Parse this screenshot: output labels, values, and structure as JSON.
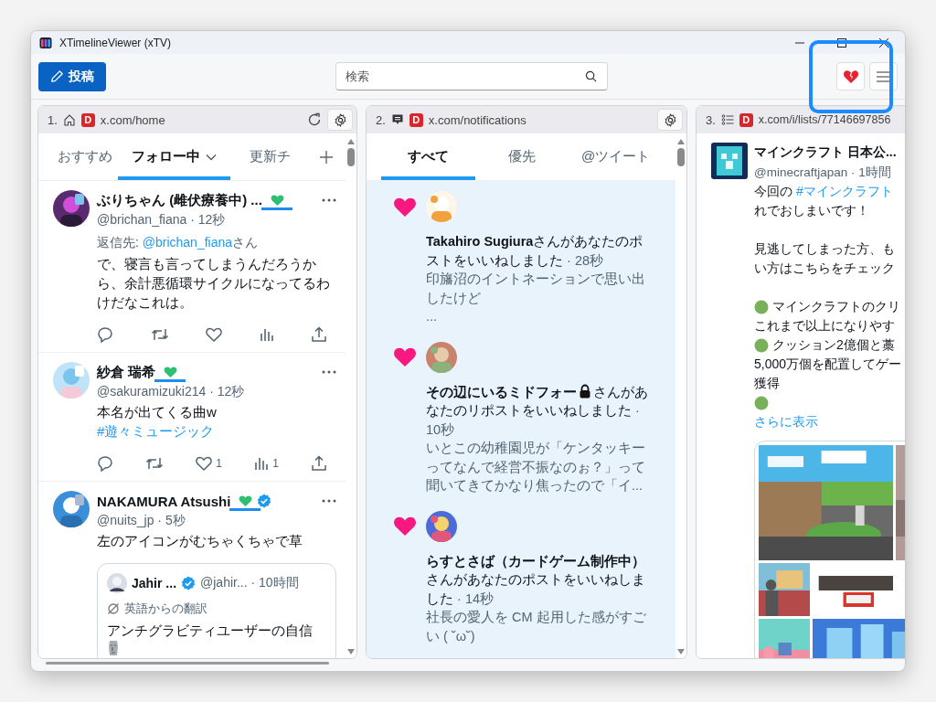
{
  "window": {
    "title": "XTimelineViewer (xTV)"
  },
  "toolbar": {
    "post_button": "投稿",
    "search": {
      "placeholder": "検索"
    },
    "highlighted": true
  },
  "columns": [
    {
      "index": "1.",
      "kind": "home",
      "badge": "D",
      "url": "x.com/home",
      "refresh": true,
      "settings": true,
      "add_tab": true,
      "unread": false,
      "tabs": [
        {
          "label": "おすすめ",
          "selected": false,
          "dropdown": false
        },
        {
          "label": "フォロー中",
          "selected": true,
          "dropdown": true
        },
        {
          "label": "更新チ",
          "selected": false,
          "dropdown": false
        }
      ],
      "posts": [
        {
          "name": "ぶりちゃん (雌伏療養中) ...",
          "green_heart": true,
          "verified": false,
          "meta": "@brichan_fiana · 12秒",
          "reply_to": {
            "label": "返信先: ",
            "handle": "@brichan_fiana",
            "suffix": "さん"
          },
          "segments": [
            {
              "kind": "text",
              "text": "で、寝言も言ってしまうんだろうから、余計悪循環サイクルになってるわけだなこれは。"
            }
          ]
        },
        {
          "name": "紗倉 瑞希",
          "green_heart": true,
          "verified": false,
          "meta": "@sakuramizuki214 · 12秒",
          "segments": [
            {
              "kind": "text",
              "text": "本名が出てくる曲w "
            },
            {
              "kind": "link",
              "text": "#遊々ミュージック"
            }
          ],
          "likes": "1",
          "views": "1"
        },
        {
          "name": "NAKAMURA Atsushi",
          "green_heart": true,
          "verified": true,
          "meta": "@nuits_jp · 5秒",
          "segments": [
            {
              "kind": "text",
              "text": "左のアイコンがむちゃくちゃで草"
            }
          ],
          "quote": {
            "name": "Jahir ...",
            "verified": true,
            "meta": "@jahir... · 10時間",
            "translated": "英語からの翻訳",
            "text": "アンチグラビティユーザーの自信"
          }
        }
      ]
    },
    {
      "index": "2.",
      "kind": "notifications",
      "badge": "D",
      "url": "x.com/notifications",
      "refresh": false,
      "settings": true,
      "add_tab": false,
      "unread": true,
      "tabs": [
        {
          "label": "すべて",
          "selected": true,
          "dropdown": false
        },
        {
          "label": "優先",
          "selected": false,
          "dropdown": false
        },
        {
          "label": "@ツイート",
          "selected": false,
          "dropdown": false
        }
      ],
      "notifications": [
        {
          "actor": "Takahiro Sugiura",
          "locked": false,
          "action": "さんがあなたのポストをいいねしました",
          "time": " · 28秒",
          "excerpt": "印旛沼のイントネーションで思い出したけど",
          "more": "..."
        },
        {
          "actor": "その辺にいるミドフォー",
          "locked": true,
          "action": "さんがあなたのリポストをいいねしました",
          "time": " · 10秒",
          "excerpt": "いとこの幼稚園児が「ケンタッキーってなんで経営不振なのぉ？」って聞いてきてかなり焦ったので「イ..."
        },
        {
          "actor": "らすとさば（カードゲーム制作中）",
          "locked": false,
          "action": "さんがあなたのポストをいいねしました",
          "time": " · 14秒",
          "excerpt": "社長の愛人を CM 起用した感がすごい ( ˘ω˘)"
        }
      ]
    },
    {
      "index": "3.",
      "kind": "list",
      "badge": "D",
      "url": "x.com/i/lists/77146697856",
      "refresh": false,
      "settings": false,
      "add_tab": false,
      "unread": false,
      "post": {
        "name": "マインクラフト 日本公...",
        "meta": "@minecraftjapan · 1時間",
        "lines": [
          {
            "kind": "text",
            "parts": [
              {
                "kind": "text",
                "text": "今回の "
              },
              {
                "kind": "link",
                "text": "#マインクラフト"
              }
            ]
          },
          {
            "kind": "text",
            "parts": [
              {
                "kind": "text",
                "text": "れでおしまいです！"
              }
            ]
          },
          {
            "kind": "blank"
          },
          {
            "kind": "text",
            "parts": [
              {
                "kind": "text",
                "text": "見逃してしまった方、も"
              }
            ]
          },
          {
            "kind": "text",
            "parts": [
              {
                "kind": "text",
                "text": "い方はこちらをチェック"
              }
            ]
          },
          {
            "kind": "blank"
          },
          {
            "kind": "bullet",
            "parts": [
              {
                "kind": "text",
                "text": "マインクラフトのクリ"
              }
            ]
          },
          {
            "kind": "text",
            "parts": [
              {
                "kind": "text",
                "text": "これまで以上になりやす"
              }
            ]
          },
          {
            "kind": "bullet",
            "parts": [
              {
                "kind": "text",
                "text": "クッション2億個と藁"
              }
            ]
          },
          {
            "kind": "text",
            "parts": [
              {
                "kind": "text",
                "text": "5,000万個を配置してゲー"
              }
            ]
          },
          {
            "kind": "text",
            "parts": [
              {
                "kind": "text",
                "text": "獲得"
              }
            ]
          },
          {
            "kind": "bullet"
          }
        ],
        "show_more": "さらに表示"
      }
    }
  ]
}
